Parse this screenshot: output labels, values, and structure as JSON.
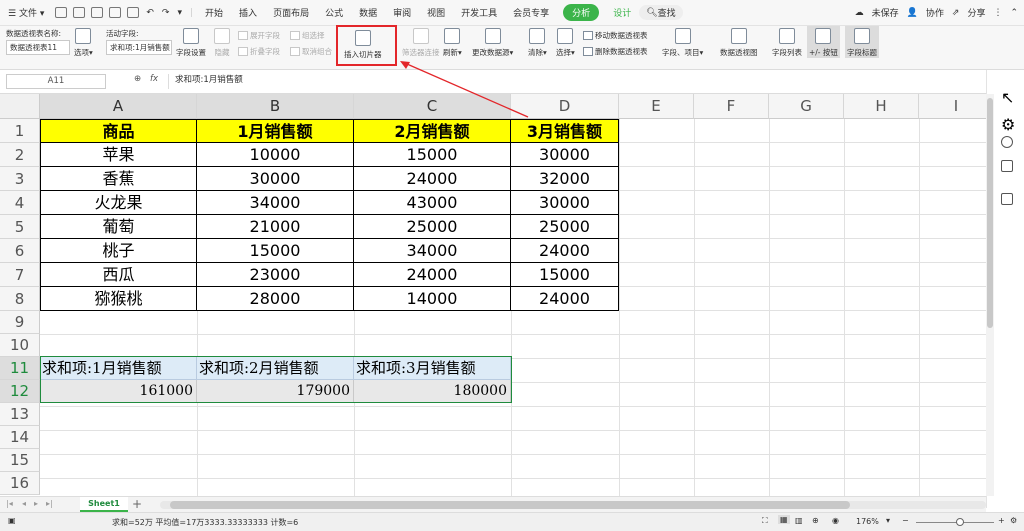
{
  "menubar": {
    "file_label": "文件",
    "tabs": [
      "开始",
      "插入",
      "页面布局",
      "公式",
      "数据",
      "审阅",
      "视图",
      "开发工具",
      "会员专享"
    ],
    "active_tab": "分析",
    "design_tab": "设计",
    "search_label": "查找",
    "unsaved_label": "未保存",
    "collab_label": "协作",
    "share_label": "分享"
  },
  "ribbon": {
    "pivot_name_label": "数据透视表名称:",
    "pivot_name_value": "数据透视表11",
    "options_label": "选项",
    "active_field_label": "活动字段:",
    "active_field_value": "求和项:1月销售额",
    "field_settings_label": "字段设置",
    "hide_label": "隐藏",
    "expand_field_label": "展开字段",
    "collapse_field_label": "折叠字段",
    "group_select_label": "组选择",
    "ungroup_label": "取消组合",
    "insert_slicer_label": "插入切片器",
    "filter_conn_label": "筛选器连接",
    "refresh_label": "刷新",
    "change_source_label": "更改数据源",
    "clear_label": "清除",
    "select_label": "选择",
    "move_pivot_label": "移动数据透视表",
    "delete_pivot_label": "删除数据透视表",
    "fields_items_label": "字段、项目",
    "pivot_chart_label": "数据透视图",
    "field_list_label": "字段列表",
    "buttons_label": "+/- 按钮",
    "field_headers_label": "字段标题"
  },
  "formula_bar": {
    "name_box": "A11",
    "fx_label": "fx",
    "formula": "求和项:1月销售额"
  },
  "grid": {
    "columns": [
      "A",
      "B",
      "C",
      "D",
      "E",
      "F",
      "G",
      "H",
      "I"
    ],
    "rows": [
      "1",
      "2",
      "3",
      "4",
      "5",
      "6",
      "7",
      "8",
      "9",
      "10",
      "11",
      "12",
      "13",
      "14",
      "15",
      "16"
    ],
    "headers": [
      "商品",
      "1月销售额",
      "2月销售额",
      "3月销售额"
    ],
    "data": [
      [
        "苹果",
        "10000",
        "15000",
        "30000"
      ],
      [
        "香蕉",
        "30000",
        "24000",
        "32000"
      ],
      [
        "火龙果",
        "34000",
        "43000",
        "30000"
      ],
      [
        "葡萄",
        "21000",
        "25000",
        "25000"
      ],
      [
        "桃子",
        "15000",
        "34000",
        "24000"
      ],
      [
        "西瓜",
        "23000",
        "24000",
        "15000"
      ],
      [
        "猕猴桃",
        "28000",
        "14000",
        "24000"
      ]
    ],
    "pivot_headers": [
      "求和项:1月销售额",
      "求和项:2月销售额",
      "求和项:3月销售额"
    ],
    "pivot_values": [
      "161000",
      "179000",
      "180000"
    ]
  },
  "sheets": {
    "active": "Sheet1",
    "add": "+"
  },
  "status": {
    "summary": "求和=52万  平均值=17万3333.33333333  计数=6",
    "zoom": "176%"
  },
  "colors": {
    "header_yellow": "#ffff00",
    "accent_green": "#3bb44a",
    "highlight_red": "#e3262a"
  }
}
